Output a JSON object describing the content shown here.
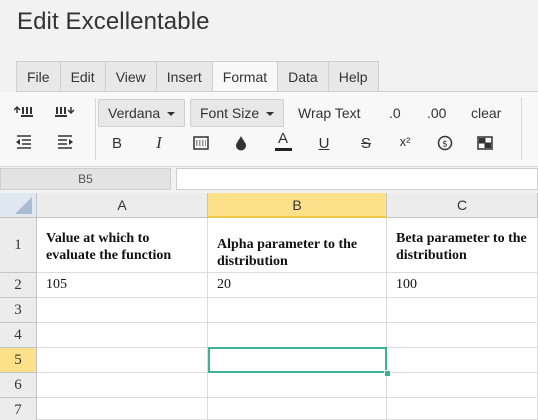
{
  "app": {
    "title": "Edit Excellentable"
  },
  "menu": {
    "tabs": [
      "File",
      "Edit",
      "View",
      "Insert",
      "Format",
      "Data",
      "Help"
    ],
    "active": "Format"
  },
  "toolbar": {
    "font_family": "Verdana",
    "font_size": "Font Size",
    "wrap_text": "Wrap Text",
    "decrease_decimal": ".0",
    "increase_decimal": ".00",
    "clear": "clear",
    "bold": "B",
    "italic": "I",
    "text_color": "A",
    "underline": "U",
    "strikethrough": "S",
    "superscript": "x²"
  },
  "formula_bar": {
    "cell_ref": "B5",
    "value": ""
  },
  "grid": {
    "columns": [
      "A",
      "B",
      "C"
    ],
    "selected_column": "B",
    "rows": [
      "1",
      "2",
      "3",
      "4",
      "5",
      "6",
      "7"
    ],
    "selected_row": "5",
    "cells": {
      "A1": "Value at which to evaluate the function",
      "B1": "Alpha parameter to the distribution",
      "C1": "Beta parameter to the distribution",
      "A2": "105",
      "B2": "20",
      "C2": "100"
    }
  },
  "colors": {
    "selection": "#3bb397",
    "header_highlight": "#fce08a"
  }
}
